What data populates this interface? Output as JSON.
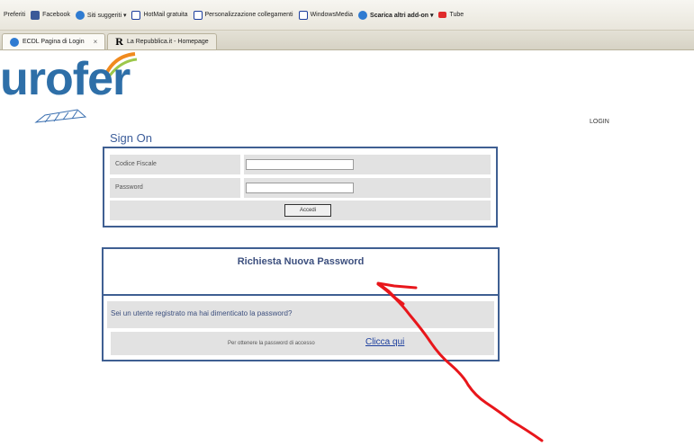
{
  "bookmarks": [
    {
      "icon": "star-icon",
      "label": "Preferiti",
      "bold": false
    },
    {
      "icon": "facebook-icon",
      "label": "Facebook",
      "bold": false
    },
    {
      "icon": "ie-icon",
      "label": "Siti suggeriti ▾",
      "bold": false
    },
    {
      "icon": "page-icon",
      "label": "HotMail gratuita",
      "bold": false
    },
    {
      "icon": "page-icon",
      "label": "Personalizzazione collegamenti",
      "bold": false
    },
    {
      "icon": "page-icon",
      "label": "WindowsMedia",
      "bold": false
    },
    {
      "icon": "ie-icon",
      "label": "Scarica altri add-on ▾",
      "bold": true
    },
    {
      "icon": "youtube-icon",
      "label": "Tube",
      "bold": false
    }
  ],
  "tabs": [
    {
      "label": "ECDL Pagina di Login",
      "active": true
    },
    {
      "label": "La Repubblica.it - Homepage",
      "active": false
    }
  ],
  "logo": {
    "text": "urofer",
    "brand_color": "#2e6fa8",
    "accent_color": "#f08a1e"
  },
  "login_link": "LOGIN",
  "signon": {
    "title": "Sign On",
    "codice_fiscale_label": "Codice Fiscale",
    "password_label": "Password",
    "accedi_label": "Accedi"
  },
  "richiesta": {
    "title": "Richiesta Nuova Password",
    "question": "Sei un utente registrato ma hai dimenticato la password?",
    "hint": "Per ottenere la password di accesso",
    "link": "Clicca qui"
  },
  "annotation_color": "#e8161b"
}
